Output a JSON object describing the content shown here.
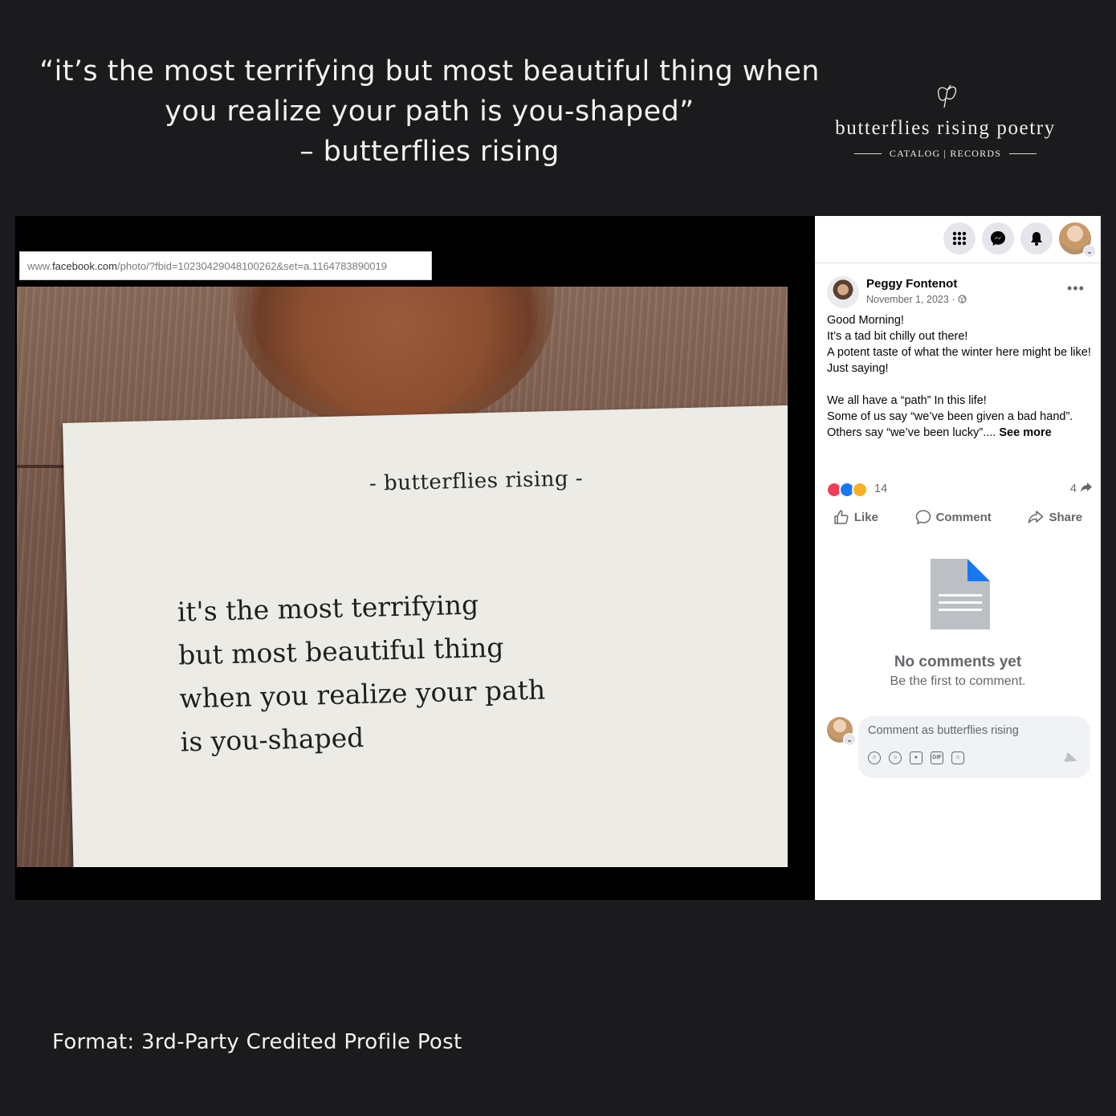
{
  "quote": {
    "lines": [
      "“it’s the most terrifying but most beautiful thing when",
      "you realize your path is you-shaped”",
      "– butterflies rising"
    ]
  },
  "brand": {
    "name": "butterflies rising poetry",
    "subtitle": "CATALOG | RECORDS",
    "icon": "butterfly-icon"
  },
  "browser": {
    "url_domain_prefix": "www.",
    "url_domain": "facebook.com",
    "url_path": "/photo/?fbid=10230429048100262&set=a.1164783890019"
  },
  "photo_card": {
    "signature": "- butterflies rising -",
    "poem_lines": [
      "it's the most terrifying",
      "but most beautiful thing",
      "when you realize your path",
      "is you-shaped"
    ]
  },
  "top_icons": [
    "menu-grid-icon",
    "messenger-icon",
    "bell-icon"
  ],
  "post": {
    "author": "Peggy Fontenot",
    "date": "November 1, 2023",
    "date_sep": " · ",
    "text_lines": [
      "Good Morning!",
      "It’s a tad bit chilly out there!",
      "A potent taste of what the winter here might be like!",
      "Just saying!",
      "",
      "We all have a “path” In this life!",
      "Some of us say “we’ve been given a bad hand”.",
      "Others say “we’ve been lucky”...."
    ],
    "see_more": "See more",
    "reaction_count": "14",
    "share_count": "4",
    "reaction_colors": {
      "love": "#f33e58",
      "like": "#1877f2",
      "care": "#f7b125"
    }
  },
  "actions": {
    "like": "Like",
    "comment": "Comment",
    "share": "Share"
  },
  "comments": {
    "empty_title": "No comments yet",
    "empty_subtitle": "Be the first to comment.",
    "input_placeholder": "Comment as butterflies rising",
    "tools": [
      "avatar-sticker-icon",
      "emoji-icon",
      "camera-icon",
      "gif-icon",
      "sticker-icon"
    ],
    "gif_label": "GIF"
  },
  "footer": {
    "format": "Format: 3rd-Party Credited Profile Post"
  }
}
